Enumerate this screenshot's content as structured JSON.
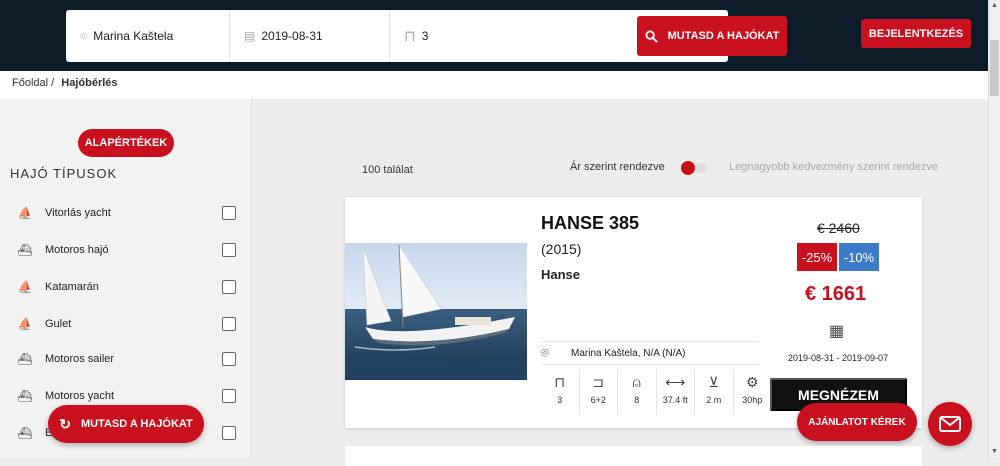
{
  "search": {
    "location": "Marina Kaštela",
    "date": "2019-08-31",
    "guests": "3",
    "button_label": "MUTASD A HAJÓKAT"
  },
  "header": {
    "login_label": "BEJELENTKEZÉS"
  },
  "breadcrumb": {
    "home": "Főoldal /",
    "current": "Hajóbérlés"
  },
  "sidebar": {
    "reset_label": "ALAPÉRTÉKEK",
    "types_title": "HAJÓ TÍPUSOK",
    "types": [
      {
        "label": "Vitorlás yacht",
        "icon": "sailboat-icon"
      },
      {
        "label": "Motoros hajó",
        "icon": "motorboat-icon"
      },
      {
        "label": "Katamarán",
        "icon": "catamaran-icon"
      },
      {
        "label": "Gulet",
        "icon": "gulet-icon"
      },
      {
        "label": "Motoros sailer",
        "icon": "motorsailer-icon"
      },
      {
        "label": "Motoros yacht",
        "icon": "motoryacht-icon"
      },
      {
        "label": "E",
        "icon": "boat-icon"
      }
    ],
    "float_button_label": "MUTASD A HAJÓKAT"
  },
  "results": {
    "count": "100 találat",
    "sort_price": "Ár szerint rendezve",
    "sort_discount": "Legnagyobb kedvezmény szerint rendezve",
    "sort_toggle_on": true
  },
  "boat": {
    "name": "HANSE 385",
    "year": "(2015)",
    "brand": "Hanse",
    "location": "Marina Kaštela, N/A (N/A)",
    "old_price": "€ 2460",
    "discount1": "-25%",
    "discount2": "-10%",
    "price": "€ 1661",
    "dates": "2019-08-31 - 2019-09-07",
    "view_label": "MEGNÉZEM",
    "specs": [
      {
        "icon": "cabin-door-icon",
        "value": "3"
      },
      {
        "icon": "bed-icon",
        "value": "6+2"
      },
      {
        "icon": "person-icon",
        "value": "8"
      },
      {
        "icon": "length-icon",
        "value": "37.4 ft"
      },
      {
        "icon": "draft-icon",
        "value": "2 m"
      },
      {
        "icon": "engine-icon",
        "value": "30hp"
      }
    ]
  },
  "actions": {
    "quote_label": "AJÁNLATOT KÉREK"
  },
  "colors": {
    "accent": "#c8101e",
    "header_bg": "#0c1b28",
    "discount_blue": "#3d7bc9"
  }
}
